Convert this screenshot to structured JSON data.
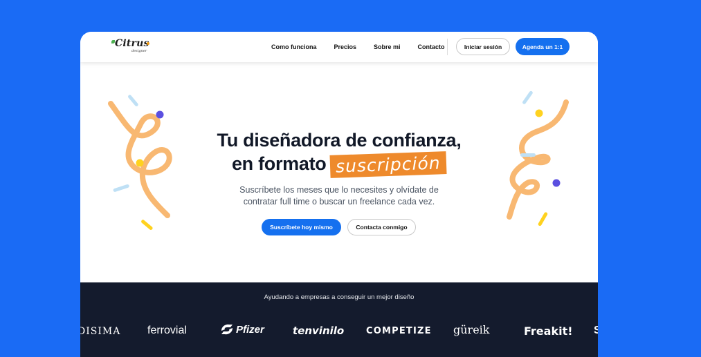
{
  "nav": {
    "logo_text": "Citrus",
    "logo_sub": "designer",
    "links": [
      "Como funciona",
      "Precios",
      "Sobre mi",
      "Contacto"
    ],
    "login_label": "Iniciar sesión",
    "book_label": "Agenda un 1:1"
  },
  "hero": {
    "title_line1": "Tu diseñadora de confianza,",
    "title_line2": "en formato",
    "title_highlight": "suscripción",
    "subtitle_line1": "Suscríbete los meses que lo necesites y olvídate de",
    "subtitle_line2": "contratar full time o buscar un freelance cada vez.",
    "cta_primary": "Suscríbete hoy mismo",
    "cta_secondary": "Contacta conmigo"
  },
  "clients": {
    "heading": "Ayudando a empresas a conseguir un mejor diseño",
    "logos": [
      "DISIMA",
      "ferrovial",
      "Pfizer",
      "tenvinilo",
      "COMPETIZE",
      "güreik",
      "Freakit!",
      "S"
    ]
  },
  "colors": {
    "background": "#1a6bf5",
    "primary": "#1570ef",
    "highlight": "#ee8a2c",
    "dark_band": "#141b2d"
  }
}
